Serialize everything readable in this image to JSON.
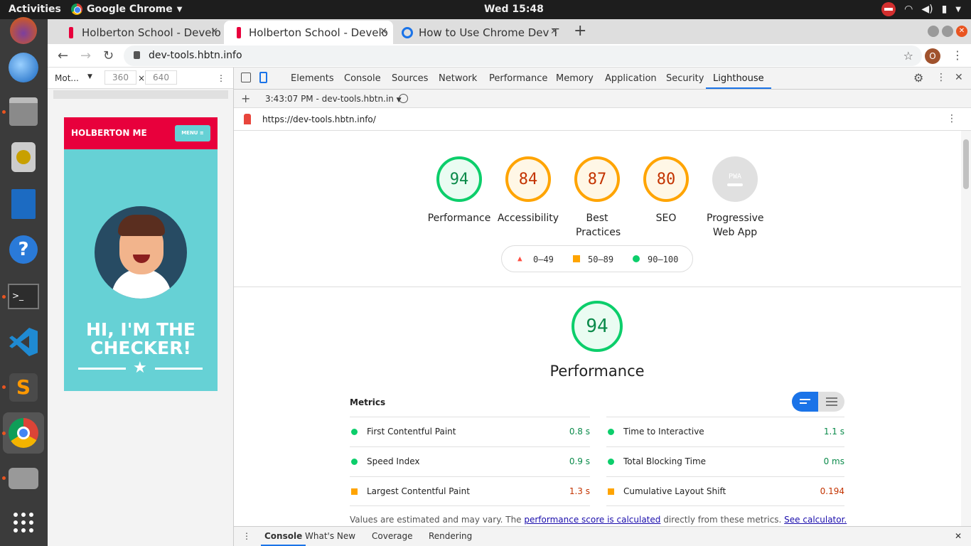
{
  "os": {
    "activities": "Activities",
    "app_name": "Google Chrome",
    "clock": "Wed 15:48"
  },
  "browser": {
    "tabs": [
      {
        "title": "Holberton School - Develo"
      },
      {
        "title": "Holberton School - Develo"
      },
      {
        "title": "How to Use Chrome Dev T"
      }
    ],
    "url": "dev-tools.hbtn.info",
    "profile_initial": "O"
  },
  "device_toolbar": {
    "device": "Mot...",
    "width": "360",
    "height": "640"
  },
  "page": {
    "brand": "HOLBERTON ME",
    "menu_label": "MENU ≡",
    "hero_line1": "HI, I'M THE",
    "hero_line2": "CHECKER!"
  },
  "devtools": {
    "tabs": [
      "Elements",
      "Console",
      "Sources",
      "Network",
      "Performance",
      "Memory",
      "Application",
      "Security",
      "Lighthouse"
    ],
    "active_tab": "Lighthouse",
    "report_select": "3:43:07 PM - dev-tools.hbtn.in",
    "report_url": "https://dev-tools.hbtn.info/",
    "drawer_tabs": [
      "Console",
      "What's New",
      "Coverage",
      "Rendering"
    ]
  },
  "lighthouse": {
    "scores": [
      {
        "label": "Performance",
        "value": "94",
        "color": "#0cce6b"
      },
      {
        "label": "Accessibility",
        "value": "84",
        "color": "#ffa400"
      },
      {
        "label": "Best Practices",
        "value": "87",
        "color": "#ffa400"
      },
      {
        "label": "SEO",
        "value": "80",
        "color": "#ffa400"
      },
      {
        "label": "Progressive Web App",
        "value": "PWA",
        "color": "#d3d3d3"
      }
    ],
    "legend": [
      "0–49",
      "50–89",
      "90–100"
    ],
    "main_score": "94",
    "main_title": "Performance",
    "metrics_heading": "Metrics",
    "metrics_left": [
      {
        "name": "First Contentful Paint",
        "value": "0.8 s",
        "status": "good"
      },
      {
        "name": "Speed Index",
        "value": "0.9 s",
        "status": "good"
      },
      {
        "name": "Largest Contentful Paint",
        "value": "1.3 s",
        "status": "average"
      }
    ],
    "metrics_right": [
      {
        "name": "Time to Interactive",
        "value": "1.1 s",
        "status": "good"
      },
      {
        "name": "Total Blocking Time",
        "value": "0 ms",
        "status": "good"
      },
      {
        "name": "Cumulative Layout Shift",
        "value": "0.194",
        "status": "average"
      }
    ],
    "note_prefix": "Values are estimated and may vary. The ",
    "note_link1": "performance score is calculated",
    "note_middle": " directly from these metrics. ",
    "note_link2": "See calculator."
  }
}
